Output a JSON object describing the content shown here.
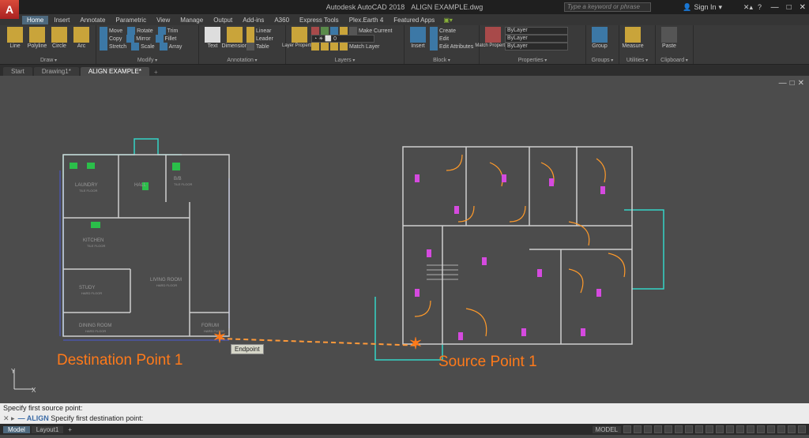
{
  "app": {
    "name": "Autodesk AutoCAD 2018",
    "doc": "ALIGN EXAMPLE.dwg"
  },
  "title": {
    "search_placeholder": "Type a keyword or phrase",
    "signin": "Sign In",
    "win": {
      "min": "—",
      "max": "□",
      "close": "✕"
    }
  },
  "menu": {
    "tabs": [
      "Home",
      "Insert",
      "Annotate",
      "Parametric",
      "View",
      "Manage",
      "Output",
      "Add-ins",
      "A360",
      "Express Tools",
      "Plex.Earth 4",
      "Featured Apps"
    ],
    "active": "Home"
  },
  "ribbon": {
    "draw": {
      "title": "Draw",
      "items": [
        "Line",
        "Polyline",
        "Circle",
        "Arc"
      ]
    },
    "modify": {
      "title": "Modify",
      "rows": [
        [
          "Move",
          "Rotate",
          "Trim"
        ],
        [
          "Copy",
          "Mirror",
          "Fillet"
        ],
        [
          "Stretch",
          "Scale",
          "Array"
        ]
      ]
    },
    "annotation": {
      "title": "Annotation",
      "big": [
        "Text",
        "Dimension"
      ],
      "rows": [
        "Linear",
        "Leader",
        "Table"
      ]
    },
    "layers": {
      "title": "Layers",
      "big": "Layer Properties",
      "rows": [
        "Make Current",
        "Match Layer"
      ],
      "dropdown": "0"
    },
    "block": {
      "title": "Block",
      "big": "Insert",
      "rows": [
        "Create",
        "Edit",
        "Edit Attributes"
      ]
    },
    "properties": {
      "title": "Properties",
      "big": "Match Properties",
      "dropdowns": [
        "ByLayer",
        "ByLayer",
        "ByLayer"
      ]
    },
    "groups": {
      "title": "Groups",
      "big": "Group"
    },
    "utilities": {
      "title": "Utilities",
      "big": "Measure"
    },
    "clipboard": {
      "title": "Clipboard",
      "big": "Paste"
    }
  },
  "filetabs": {
    "tabs": [
      {
        "label": "Start",
        "active": false
      },
      {
        "label": "Drawing1*",
        "active": false
      },
      {
        "label": "ALIGN EXAMPLE*",
        "active": true
      }
    ],
    "plus": "+"
  },
  "canvas": {
    "ucs": {
      "x": "X",
      "y": "Y"
    },
    "viewctrl": {
      "min": "—",
      "max": "□",
      "close": "✕"
    },
    "tooltip": "Endpoint",
    "annot_dest": "Destination Point 1",
    "annot_src": "Source Point 1",
    "left_rooms": [
      "LAUNDRY",
      "HALL",
      "B/B",
      "KITCHEN",
      "STUDY",
      "LIVING ROOM",
      "DINING ROOM",
      "FORUM"
    ],
    "left_sub": [
      "TILE FLOOR",
      "TILE FLOOR",
      "TILE FLOOR",
      "TILE FLOOR",
      "HARD FLOOR",
      "HARD FLOOR",
      "HARD FLOOR",
      "HARD FLOOR"
    ]
  },
  "cmd": {
    "history": "Specify first source point:",
    "icons": "✕ ▸",
    "prefix": "— ALIGN",
    "prompt": "Specify first destination point:"
  },
  "status": {
    "tabs": [
      "Model",
      "Layout1"
    ],
    "right_label": "MODEL"
  }
}
